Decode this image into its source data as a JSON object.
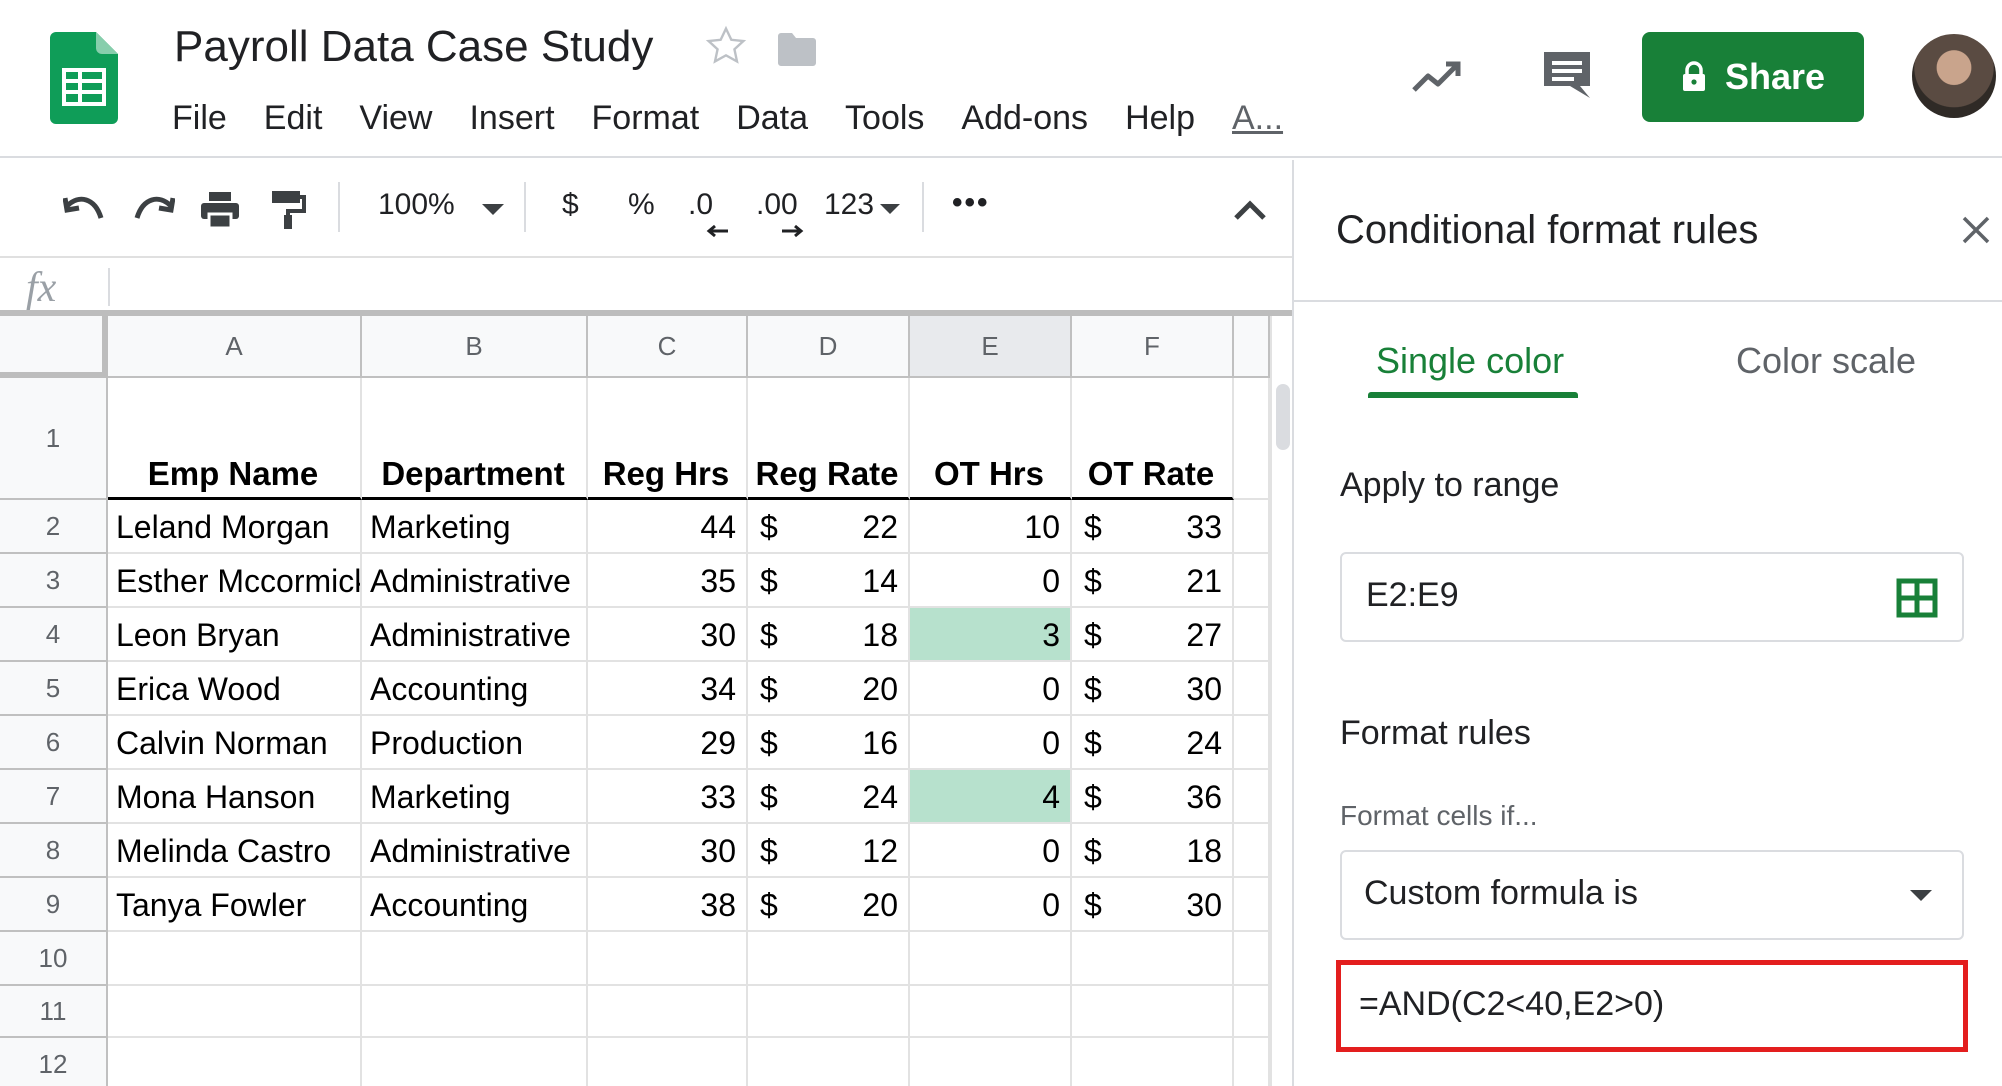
{
  "header": {
    "title": "Payroll Data Case Study",
    "menu": [
      "File",
      "Edit",
      "View",
      "Insert",
      "Format",
      "Data",
      "Tools",
      "Add-ons",
      "Help"
    ],
    "menu_more": "A...",
    "share_label": "Share",
    "icons": [
      "sheets-logo-icon",
      "star-icon",
      "folder-icon",
      "trend-icon",
      "comment-icon",
      "lock-icon"
    ]
  },
  "toolbar": {
    "zoom": "100%",
    "currency": "$",
    "percent": "%",
    "decrease_decimal": ".0",
    "increase_decimal": ".00",
    "number_format": "123",
    "more": "•••",
    "icons": [
      "undo-icon",
      "redo-icon",
      "print-icon",
      "paint-format-icon",
      "collapse-icon"
    ]
  },
  "formula_bar": {
    "fx": "fx",
    "value": ""
  },
  "sheet": {
    "columns": [
      "A",
      "B",
      "C",
      "D",
      "E",
      "F"
    ],
    "selected_column": "E",
    "row_numbers": [
      "1",
      "2",
      "3",
      "4",
      "5",
      "6",
      "7",
      "8",
      "9",
      "10",
      "11",
      "12"
    ],
    "headers": [
      "Emp Name",
      "Department",
      "Reg Hrs",
      "Reg Rate",
      "OT Hrs",
      "OT Rate"
    ],
    "currency_symbol": "$",
    "rows": [
      {
        "name": "Leland Morgan",
        "dept": "Marketing",
        "reg_hrs": "44",
        "reg_rate": "22",
        "ot_hrs": "10",
        "ot_rate": "33",
        "highlight": false
      },
      {
        "name": "Esther Mccormick",
        "dept": "Administrative",
        "reg_hrs": "35",
        "reg_rate": "14",
        "ot_hrs": "0",
        "ot_rate": "21",
        "highlight": false
      },
      {
        "name": "Leon Bryan",
        "dept": "Administrative",
        "reg_hrs": "30",
        "reg_rate": "18",
        "ot_hrs": "3",
        "ot_rate": "27",
        "highlight": true
      },
      {
        "name": "Erica Wood",
        "dept": "Accounting",
        "reg_hrs": "34",
        "reg_rate": "20",
        "ot_hrs": "0",
        "ot_rate": "30",
        "highlight": false
      },
      {
        "name": "Calvin Norman",
        "dept": "Production",
        "reg_hrs": "29",
        "reg_rate": "16",
        "ot_hrs": "0",
        "ot_rate": "24",
        "highlight": false
      },
      {
        "name": "Mona Hanson",
        "dept": "Marketing",
        "reg_hrs": "33",
        "reg_rate": "24",
        "ot_hrs": "4",
        "ot_rate": "36",
        "highlight": true
      },
      {
        "name": "Melinda Castro",
        "dept": "Administrative",
        "reg_hrs": "30",
        "reg_rate": "12",
        "ot_hrs": "0",
        "ot_rate": "18",
        "highlight": false
      },
      {
        "name": "Tanya Fowler",
        "dept": "Accounting",
        "reg_hrs": "38",
        "reg_rate": "20",
        "ot_hrs": "0",
        "ot_rate": "30",
        "highlight": false
      }
    ],
    "highlight_color": "#b7e1cd"
  },
  "panel": {
    "title": "Conditional format rules",
    "tabs": [
      "Single color",
      "Color scale"
    ],
    "active_tab": "Single color",
    "apply_to_range_label": "Apply to range",
    "range": "E2:E9",
    "format_rules_label": "Format rules",
    "format_cells_if_label": "Format cells if...",
    "condition": "Custom formula is",
    "formula": "=AND(C2<40,E2>0)",
    "accent_color": "#188038",
    "formula_outline_color": "#e31e1e"
  }
}
